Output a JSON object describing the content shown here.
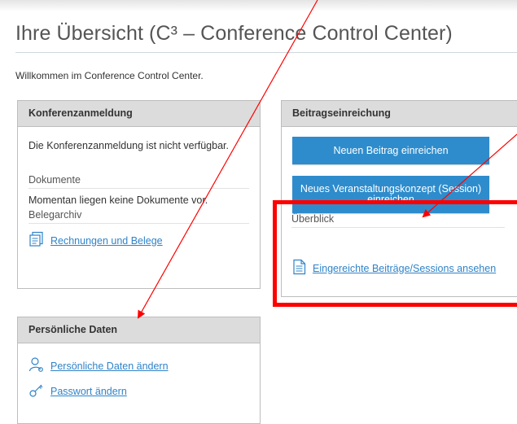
{
  "page": {
    "title": "Ihre Übersicht (C³ – Conference Control Center)",
    "welcome": "Willkommen im Conference Control Center."
  },
  "registration": {
    "header": "Konferenzanmeldung",
    "status": "Die Konferenzanmeldung ist nicht verfügbar.",
    "documents_heading": "Dokumente",
    "documents_text": "Momentan liegen keine Dokumente vor.",
    "archive_heading": "Belegarchiv",
    "archive_link": "Rechnungen und Belege"
  },
  "submission": {
    "header": "Beitragseinreichung",
    "new_paper_button": "Neuen Beitrag einreichen",
    "new_session_button": "Neues Veranstaltungskonzept (Session) einreichen",
    "overview_heading": "Überblick",
    "overview_link": "Eingereichte Beiträge/Sessions ansehen"
  },
  "personal": {
    "header": "Persönliche Daten",
    "edit_link": "Persönliche Daten ändern",
    "password_link": "Passwort ändern"
  },
  "annotation": {
    "arrow_color": "#ff0000",
    "highlight_color": "#ff0000"
  }
}
